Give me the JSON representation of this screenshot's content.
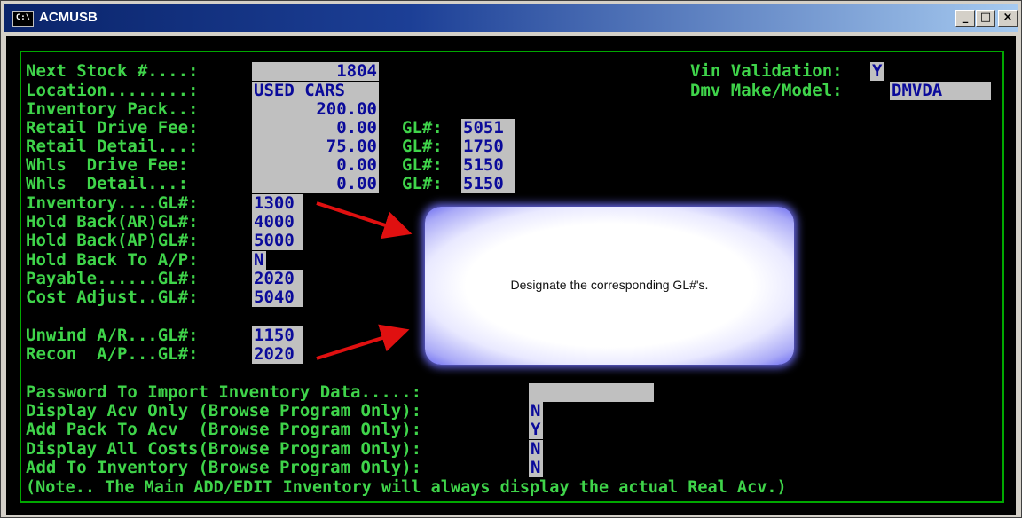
{
  "window": {
    "title": "ACMUSB",
    "icon_text": "C:\\",
    "minimize": "_",
    "maximize": "□",
    "close": "×"
  },
  "rows": [
    {
      "label": "Next Stock #....:",
      "value": "1804"
    },
    {
      "label": "Location........:",
      "value": "USED CARS"
    },
    {
      "label": "Inventory Pack..:",
      "value": "200.00"
    },
    {
      "label": "Retail Drive Fee:",
      "value": "0.00",
      "gl_label": "GL#:",
      "gl": "5051"
    },
    {
      "label": "Retail Detail...:",
      "value": "75.00",
      "gl_label": "GL#:",
      "gl": "1750"
    },
    {
      "label": "Whls  Drive Fee:",
      "value": "0.00",
      "gl_label": "GL#:",
      "gl": "5150"
    },
    {
      "label": "Whls  Detail...:",
      "value": "0.00",
      "gl_label": "GL#:",
      "gl": "5150"
    },
    {
      "label": "Inventory....GL#:",
      "value": "1300"
    },
    {
      "label": "Hold Back(AR)GL#:",
      "value": "4000"
    },
    {
      "label": "Hold Back(AP)GL#:",
      "value": "5000"
    },
    {
      "label": "Hold Back To A/P:",
      "value": "N"
    },
    {
      "label": "Payable......GL#:",
      "value": "2020"
    },
    {
      "label": "Cost Adjust..GL#:",
      "value": "5040"
    },
    {
      "label": "Unwind A/R...GL#:",
      "value": "1150"
    },
    {
      "label": "Recon  A/P...GL#:",
      "value": "2020"
    }
  ],
  "right": {
    "vin_label": "Vin Validation:",
    "vin_value": "Y",
    "dmv_label": "Dmv Make/Model:",
    "dmv_value": "DMVDA"
  },
  "options": [
    {
      "label": "Password To Import Inventory Data.....:",
      "value": ""
    },
    {
      "label": "Display Acv Only (Browse Program Only):",
      "value": "N"
    },
    {
      "label": "Add Pack To Acv  (Browse Program Only):",
      "value": "Y"
    },
    {
      "label": "Display All Costs(Browse Program Only):",
      "value": "N"
    },
    {
      "label": "Add To Inventory (Browse Program Only):",
      "value": "N"
    }
  ],
  "note": "(Note.. The Main ADD/EDIT Inventory will always display the actual Real Acv.)",
  "callout": {
    "text": "Designate the corresponding GL#'s."
  },
  "colors": {
    "terminal_text": "#3fd44a",
    "field_bg": "#c0c0c0",
    "field_text": "#0a0a9a",
    "arrow": "#e01010",
    "title_bar": "#0a246a"
  }
}
